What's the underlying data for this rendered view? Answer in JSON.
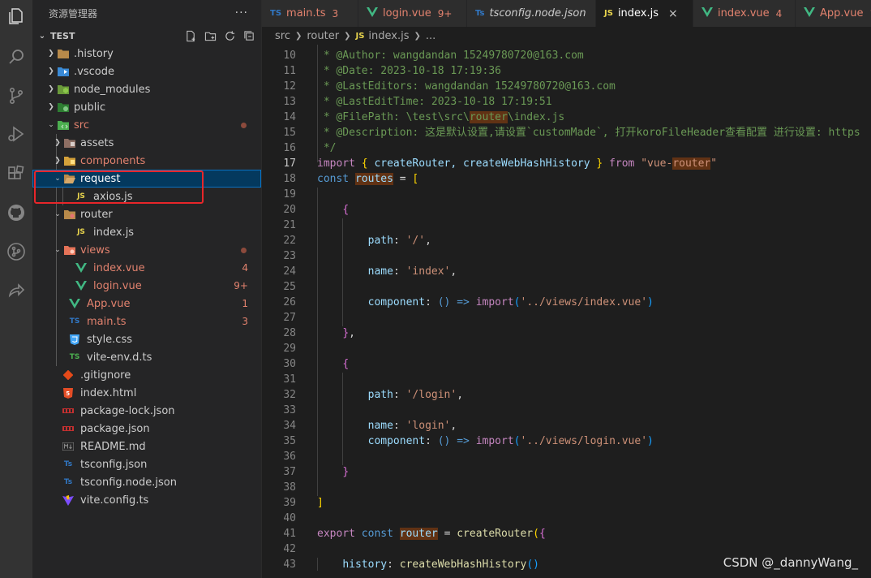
{
  "sidebar": {
    "title": "资源管理器",
    "more_label": "···",
    "root": "TEST",
    "items": [
      {
        "label": ".history",
        "badge": ""
      },
      {
        "label": ".vscode",
        "badge": ""
      },
      {
        "label": "node_modules",
        "badge": ""
      },
      {
        "label": "public",
        "badge": ""
      },
      {
        "label": "src",
        "badge": ""
      },
      {
        "label": "assets",
        "badge": ""
      },
      {
        "label": "components",
        "badge": ""
      },
      {
        "label": "request",
        "badge": ""
      },
      {
        "label": "axios.js",
        "badge": ""
      },
      {
        "label": "router",
        "badge": ""
      },
      {
        "label": "index.js",
        "badge": ""
      },
      {
        "label": "views",
        "badge": ""
      },
      {
        "label": "index.vue",
        "badge": "4"
      },
      {
        "label": "login.vue",
        "badge": "9+"
      },
      {
        "label": "App.vue",
        "badge": "1"
      },
      {
        "label": "main.ts",
        "badge": "3"
      },
      {
        "label": "style.css",
        "badge": ""
      },
      {
        "label": "vite-env.d.ts",
        "badge": ""
      },
      {
        "label": ".gitignore",
        "badge": ""
      },
      {
        "label": "index.html",
        "badge": ""
      },
      {
        "label": "package-lock.json",
        "badge": ""
      },
      {
        "label": "package.json",
        "badge": ""
      },
      {
        "label": "README.md",
        "badge": ""
      },
      {
        "label": "tsconfig.json",
        "badge": ""
      },
      {
        "label": "tsconfig.node.json",
        "badge": ""
      },
      {
        "label": "vite.config.ts",
        "badge": ""
      }
    ]
  },
  "tabs": [
    {
      "icon": "TS",
      "label": "main.ts",
      "badge": "3"
    },
    {
      "icon": "V",
      "label": "login.vue",
      "badge": "9+"
    },
    {
      "icon": "TS",
      "label": "tsconfig.node.json",
      "badge": ""
    },
    {
      "icon": "JS",
      "label": "index.js",
      "badge": "",
      "close": "×"
    },
    {
      "icon": "V",
      "label": "index.vue",
      "badge": "4"
    },
    {
      "icon": "V",
      "label": "App.vue",
      "badge": "1"
    }
  ],
  "breadcrumb": {
    "part1": "src",
    "part2": "router",
    "js_icon": "JS",
    "part3": "index.js",
    "part4": "..."
  },
  "editor": {
    "line_numbers": [
      "10",
      "11",
      "12",
      "13",
      "14",
      "15",
      "16",
      "17",
      "18",
      "19",
      "20",
      "21",
      "22",
      "23",
      "24",
      "25",
      "26",
      "27",
      "28",
      "29",
      "30",
      "31",
      "32",
      "33",
      "34",
      "35",
      "36",
      "37",
      "38",
      "39",
      "40",
      "41",
      "42",
      "43"
    ],
    "l10": " * @Author: wangdandan 15249780720@163.com",
    "l11": " * @Date: 2023-10-18 17:19:36",
    "l12": " * @LastEditors: wangdandan 15249780720@163.com",
    "l13": " * @LastEditTime: 2023-10-18 17:19:51",
    "l14a": " * @FilePath: \\test\\src\\",
    "l14b": "router",
    "l14c": "\\index.js",
    "l15": " * @Description: 这是默认设置,请设置`customMade`, 打开koroFileHeader查看配置 进行设置: https",
    "l16": " */",
    "l17_import": "import",
    "l17_names": "createRouter, createWebHashHistory",
    "l17_from": "from",
    "l17_str": "\"vue-router\"",
    "l17_str_a": "\"vue-",
    "l17_str_b": "router",
    "l17_str_c": "\"",
    "l18_const": "const",
    "l18_var": "routes",
    "l22_key": "path",
    "l22_val": "'/'",
    "l24_key": "name",
    "l24_val": "'index'",
    "l26_key": "component",
    "l26_arrow": "() =>",
    "l26_fn": "import",
    "l26_val": "'../views/index.vue'",
    "l32_val": "'/login'",
    "l34_val": "'login'",
    "l35_val": "'../views/login.vue'",
    "l41_export": "export",
    "l41_const": "const",
    "l41_var": "router",
    "l41_fn": "createRouter",
    "l43_key": "history",
    "l43_fn": "createWebHashHistory"
  },
  "watermark": "CSDN @_dannyWang_"
}
